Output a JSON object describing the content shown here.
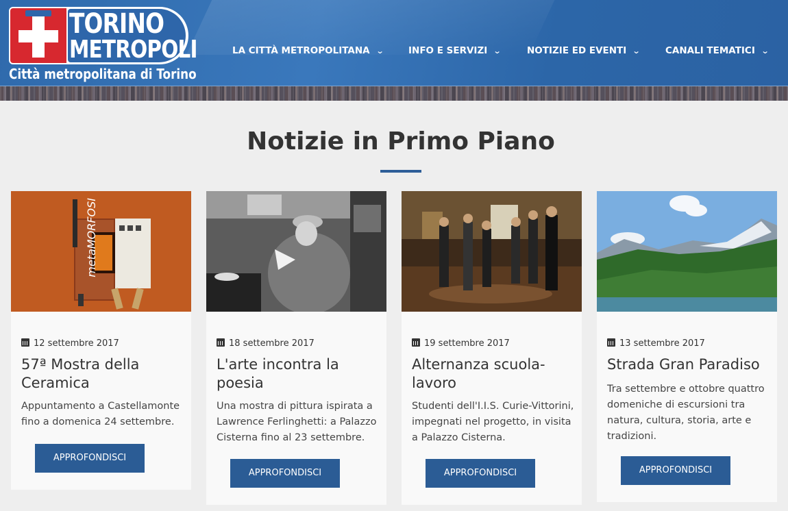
{
  "header": {
    "logo_line1": "TORINO",
    "logo_line2": "METROPOLI",
    "subtitle": "Città metropolitana di Torino",
    "nav": [
      {
        "label": "LA CITTÀ METROPOLITANA"
      },
      {
        "label": "INFO E SERVIZI"
      },
      {
        "label": "NOTIZIE ED EVENTI"
      },
      {
        "label": "CANALI TEMATICI"
      }
    ],
    "chevron": "⌄"
  },
  "section": {
    "title": "Notizie in Primo Piano"
  },
  "cards": [
    {
      "date": "12 settembre 2017",
      "title": "57ª Mostra della Ceramica",
      "description": "Appuntamento a Castellamonte fino a domenica 24 settembre.",
      "button": "APPROFONDISCI",
      "image_caption": "metaMORFOSI"
    },
    {
      "date": "18 settembre 2017",
      "title": "L'arte incontra la poesia",
      "description": "Una mostra di pittura ispirata a Lawrence Ferlinghetti: a Palazzo Cisterna fino al 23 settembre.",
      "button": "APPROFONDISCI"
    },
    {
      "date": "19 settembre 2017",
      "title": "Alternanza scuola-lavoro",
      "description": "Studenti dell'I.I.S. Curie-Vittorini, impegnati nel progetto, in visita a Palazzo Cisterna.",
      "button": "APPROFONDISCI"
    },
    {
      "date": "13 settembre 2017",
      "title": "Strada Gran Paradiso",
      "description": "Tra settembre e ottobre quattro domeniche di escursioni tra natura, cultura, storia, arte e tradizioni.",
      "button": "APPROFONDISCI"
    }
  ],
  "colors": {
    "header_blue": "#2f6aac",
    "button_blue": "#2b5c95",
    "accent_bar": "#2e5e98",
    "logo_red": "#d7282f"
  }
}
